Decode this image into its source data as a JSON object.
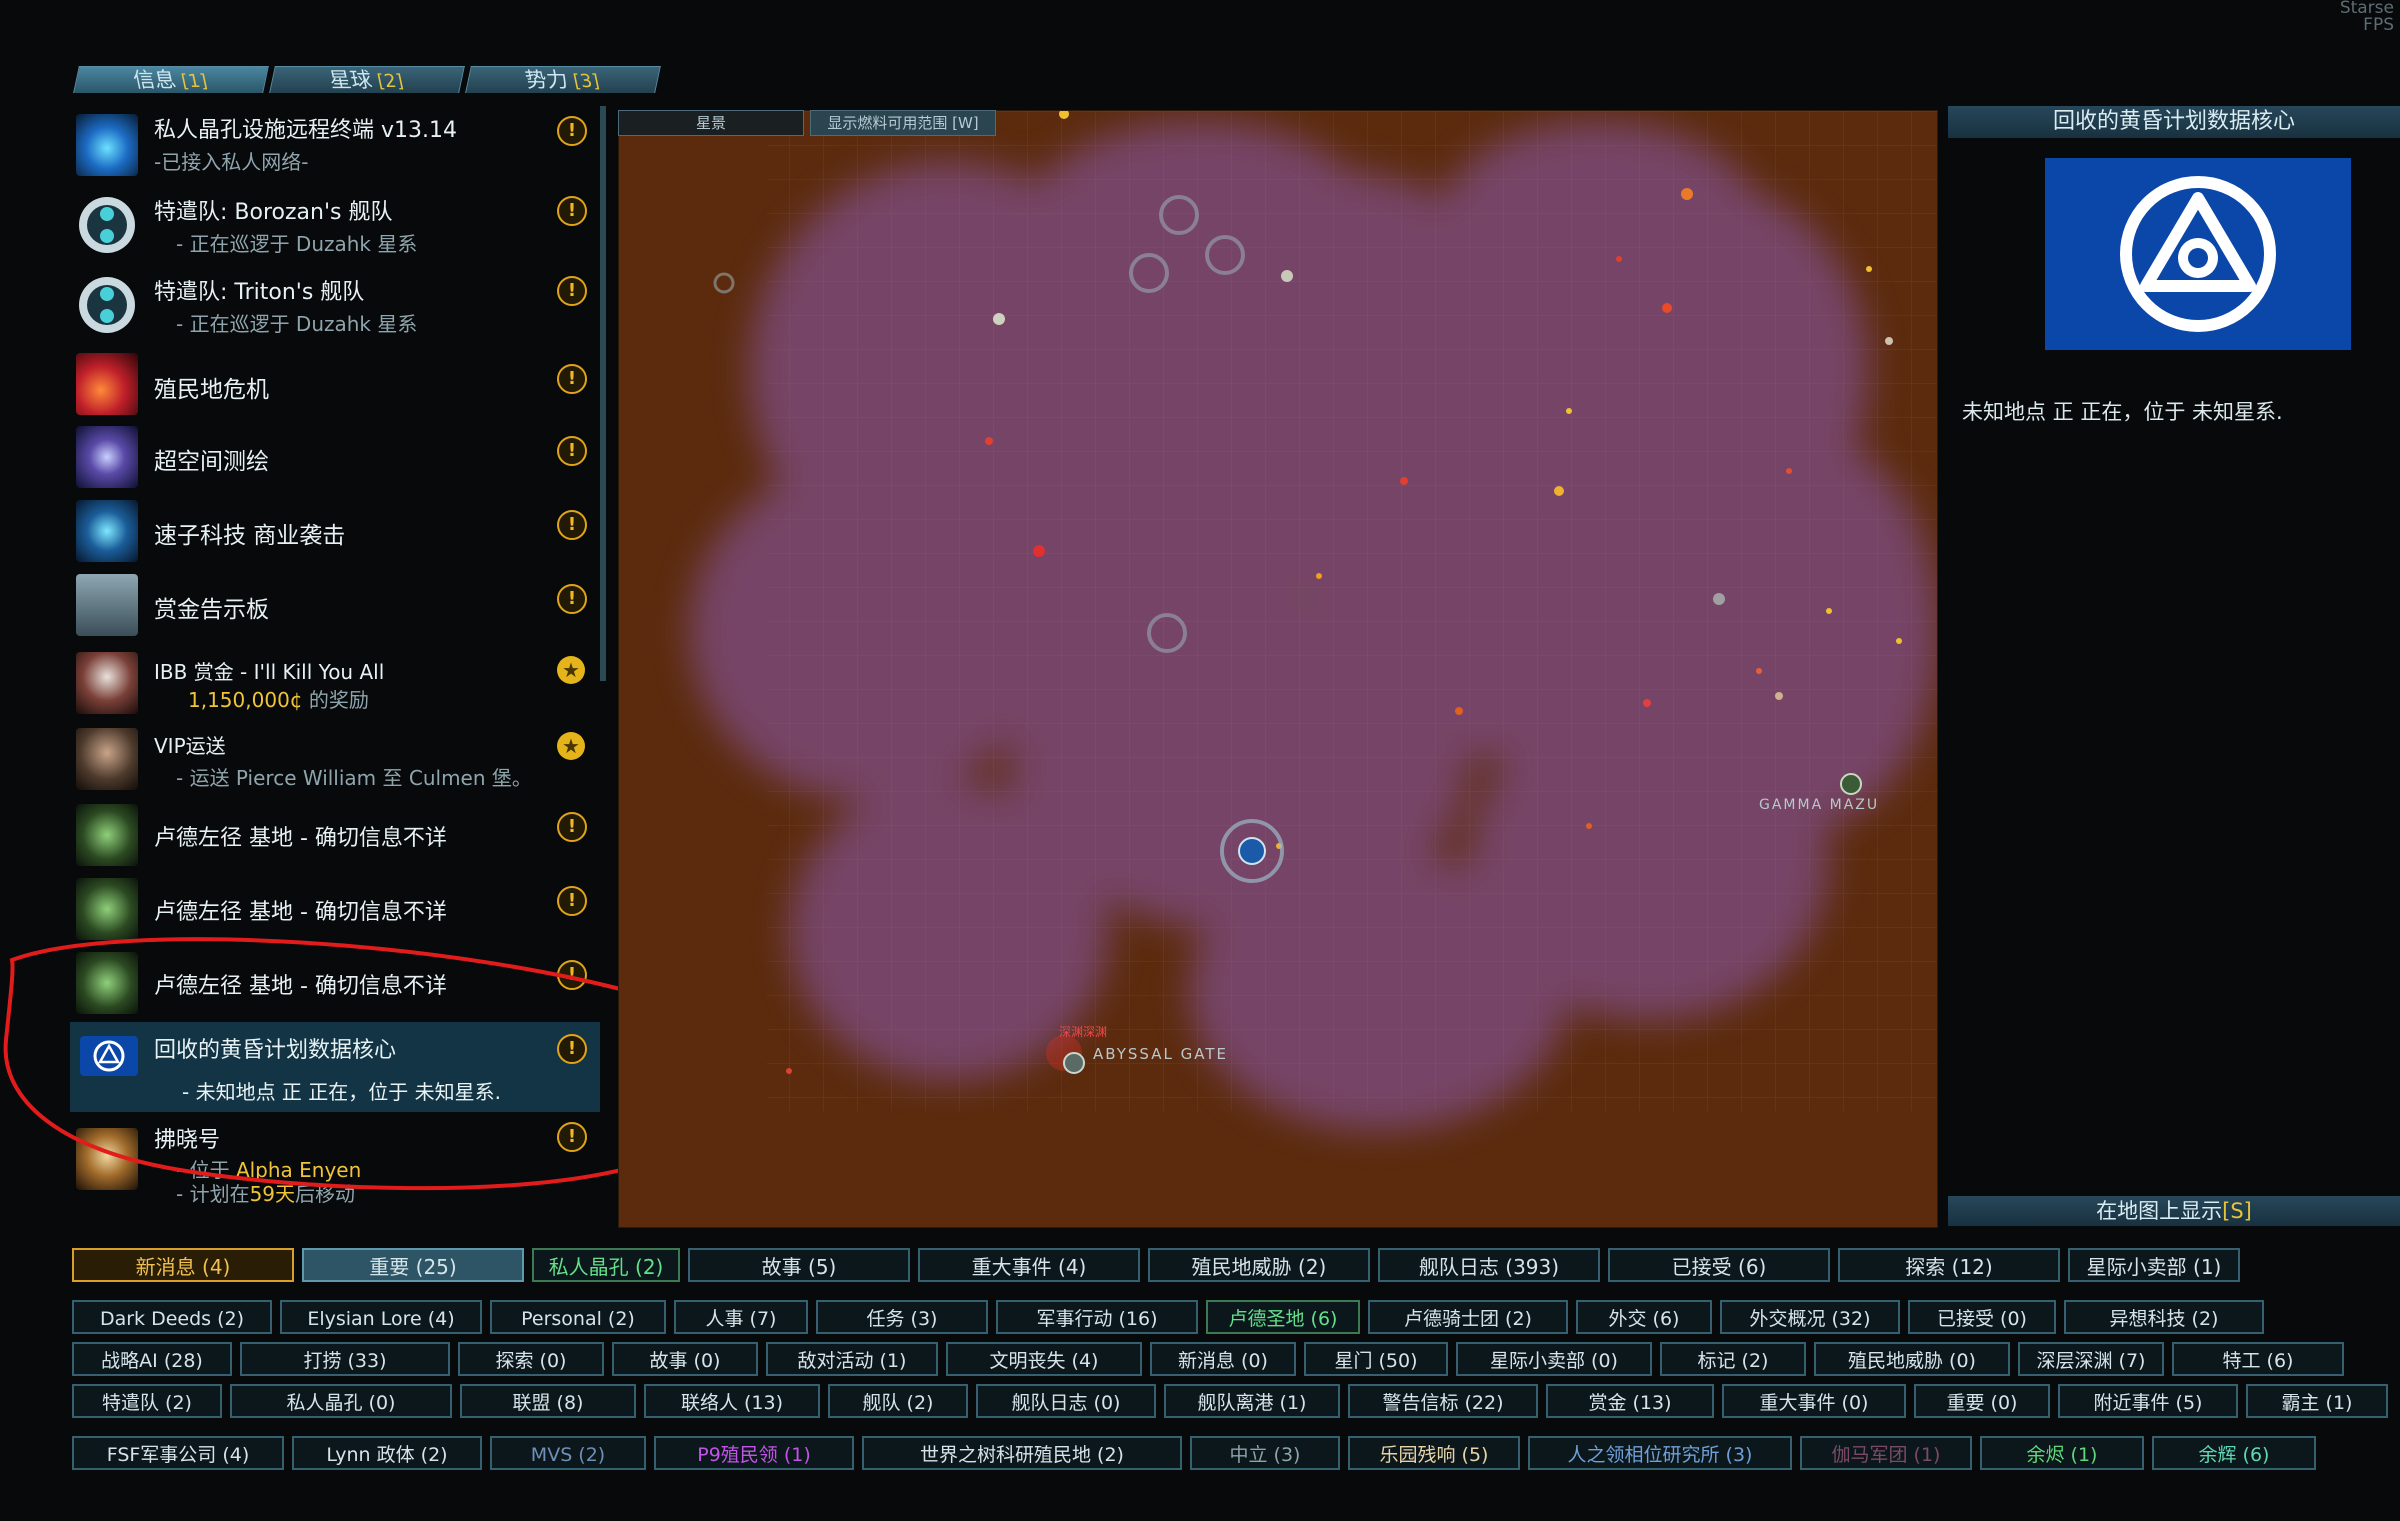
{
  "corner": {
    "line1": "Starse",
    "line2": "FPS"
  },
  "top_tabs": [
    {
      "label": "信息",
      "hotkey": "[1]"
    },
    {
      "label": "星球",
      "hotkey": "[2]"
    },
    {
      "label": "势力",
      "hotkey": "[3]"
    }
  ],
  "intel_items": [
    {
      "title": "私人晶孔设施远程终端 v13.14",
      "sub": "-已接入私人网络-",
      "marker": "!"
    },
    {
      "title": "特遣队: Borozan's 舰队",
      "sub": "- 正在巡逻于 Duzahk 星系",
      "marker": "!"
    },
    {
      "title": "特遣队: Triton's 舰队",
      "sub": "- 正在巡逻于 Duzahk 星系",
      "marker": "!"
    },
    {
      "title": "殖民地危机",
      "sub": "",
      "marker": "!"
    },
    {
      "title": "超空间测绘",
      "sub": "",
      "marker": "!"
    },
    {
      "title": "速子科技 商业袭击",
      "sub": "",
      "marker": "!"
    },
    {
      "title": "赏金告示板",
      "sub": "",
      "marker": "!"
    },
    {
      "title": "IBB 赏金 - I'll Kill You All",
      "sub_amount": "1,150,000¢",
      "sub_rest": " 的奖励",
      "marker": "★"
    },
    {
      "title": "VIP运送",
      "sub": "- 运送 Pierce William 至 Culmen 堡。",
      "marker": "★"
    },
    {
      "title": "卢德左径 基地 - 确切信息不详",
      "sub": "",
      "marker": "!"
    },
    {
      "title": "卢德左径 基地 - 确切信息不详",
      "sub": "",
      "marker": "!"
    },
    {
      "title": "卢德左径 基地 - 确切信息不详",
      "sub": "",
      "marker": "!"
    },
    {
      "title": "回收的黄昏计划数据核心",
      "sub": "- 未知地点 正 正在，位于 未知星系.",
      "marker": "!"
    },
    {
      "title": "拂晓号",
      "sub_loc_prefix": "- 位于 ",
      "sub_loc": "Alpha Enyen",
      "sub2_prefix": "- 计划在",
      "sub2_days": "59天",
      "sub2_rest": "后移动",
      "marker": "!"
    }
  ],
  "map": {
    "tabs": [
      "星景",
      "显示燃料可用范围 [W]"
    ],
    "labels": {
      "abyssal": "ABYSSAL GATE",
      "abyssal_red": "深渊深渊",
      "gamma": "GAMMA MAZU"
    }
  },
  "right_panel": {
    "title": "回收的黄昏计划数据核心",
    "desc": "未知地点 正 正在，位于 未知星系.",
    "show_on_map": "在地图上显示",
    "show_on_map_hotkey": "[S]"
  },
  "filters": {
    "row1": [
      "新消息 (4)",
      "重要 (25)",
      "私人晶孔 (2)",
      "故事 (5)",
      "重大事件 (4)",
      "殖民地威胁 (2)",
      "舰队日志 (393)",
      "已接受 (6)",
      "探索 (12)",
      "星际小卖部 (1)"
    ],
    "row2": [
      "Dark Deeds (2)",
      "Elysian Lore (4)",
      "Personal (2)",
      "人事 (7)",
      "任务 (3)",
      "军事行动 (16)",
      "卢德圣地 (6)",
      "卢德骑士团 (2)",
      "外交 (6)",
      "外交概况 (32)",
      "已接受 (0)",
      "异想科技 (2)"
    ],
    "row3": [
      "战略AI (28)",
      "打捞 (33)",
      "探索 (0)",
      "故事 (0)",
      "敌对活动 (1)",
      "文明丧失 (4)",
      "新消息 (0)",
      "星门 (50)",
      "星际小卖部 (0)",
      "标记 (2)",
      "殖民地威胁 (0)",
      "深层深渊 (7)",
      "特工 (6)"
    ],
    "row4": [
      "特遣队 (2)",
      "私人晶孔 (0)",
      "联盟 (8)",
      "联络人 (13)",
      "舰队 (2)",
      "舰队日志 (0)",
      "舰队离港 (1)",
      "警告信标 (22)",
      "赏金 (13)",
      "重大事件 (0)",
      "重要 (0)",
      "附近事件 (5)",
      "霸主 (1)"
    ],
    "row5": [
      "FSF军事公司 (4)",
      "Lynn 政体 (2)",
      "MVS (2)",
      "P9殖民领 (1)",
      "世界之树科研殖民地 (2)",
      "中立 (3)",
      "乐园残响 (5)",
      "人之领相位研究所 (3)",
      "伽马军团 (1)",
      "余烬 (1)",
      "余辉 (6)"
    ],
    "row5_colors": [
      "#d5e4e9",
      "#d5e4e9",
      "#6f8fb8",
      "#c254e8",
      "#d5e4e9",
      "#8ea4ab",
      "#e8d4a8",
      "#6fa0d8",
      "#7a4a66",
      "#5fd87c",
      "#5fd8b4"
    ]
  }
}
